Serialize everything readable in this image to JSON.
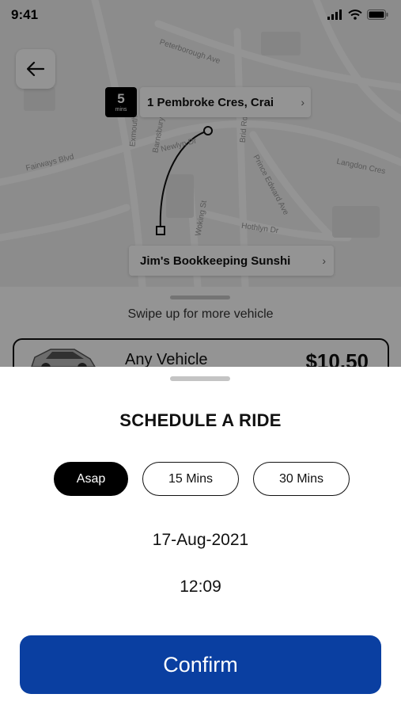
{
  "status_bar": {
    "time": "9:41"
  },
  "map": {
    "streets": [
      "Fairways Blvd",
      "Langdon Cres",
      "Prince Edward Ave",
      "Hothlyn Dr",
      "Woking St",
      "Newlyn Dr",
      "Exmouth",
      "Barnsbury",
      "Brid Rd",
      "Peterborough Ave"
    ],
    "pickup": {
      "eta_number": "5",
      "eta_unit": "mins",
      "address": "1 Pembroke Cres, Crai"
    },
    "dropoff": {
      "address": "Jim's Bookkeeping Sunshi"
    }
  },
  "vehicle_panel": {
    "swipe_hint": "Swipe up for more vehicle",
    "vehicle_name": "Any Vehicle",
    "price": "$10.50"
  },
  "sheet": {
    "title": "SCHEDULE A RIDE",
    "options": [
      "Asap",
      "15 Mins",
      "30 Mins"
    ],
    "selected_option": "Asap",
    "date": "17-Aug-2021",
    "time": "12:09",
    "confirm_label": "Confirm"
  },
  "colors": {
    "confirm_blue": "#0a3fa1",
    "selected_pill": "#000000"
  }
}
